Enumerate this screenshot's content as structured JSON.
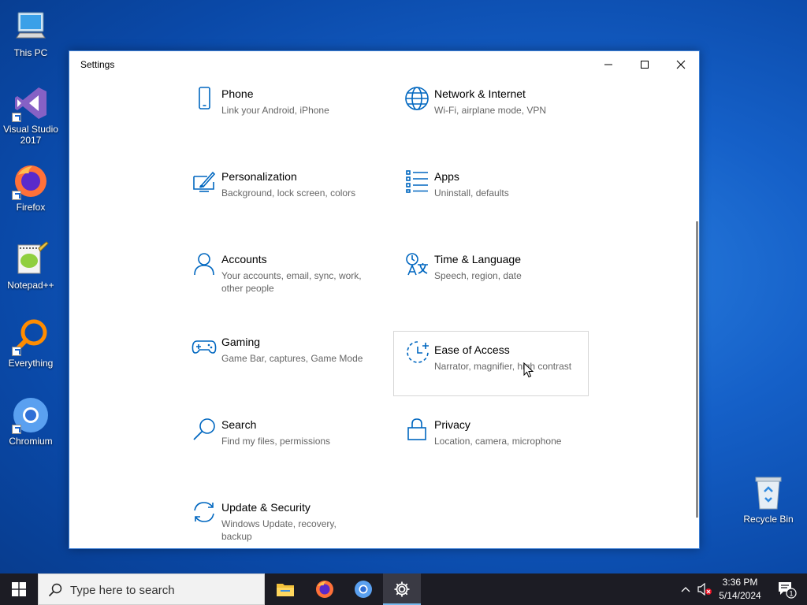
{
  "desktop": {
    "icons": [
      {
        "label": "This PC"
      },
      {
        "label": "Visual Studio 2017"
      },
      {
        "label": "Firefox"
      },
      {
        "label": "Notepad++"
      },
      {
        "label": "Everything"
      },
      {
        "label": "Chromium"
      },
      {
        "label": "Recycle Bin"
      }
    ]
  },
  "window": {
    "title": "Settings",
    "tiles": [
      {
        "name": "Phone",
        "desc": "Link your Android, iPhone",
        "icon": "phone-icon"
      },
      {
        "name": "Network & Internet",
        "desc": "Wi-Fi, airplane mode, VPN",
        "icon": "globe-icon"
      },
      {
        "name": "Personalization",
        "desc": "Background, lock screen, colors",
        "icon": "paintbrush-icon"
      },
      {
        "name": "Apps",
        "desc": "Uninstall, defaults",
        "icon": "apps-list-icon"
      },
      {
        "name": "Accounts",
        "desc": "Your accounts, email, sync, work, other people",
        "icon": "person-icon"
      },
      {
        "name": "Time & Language",
        "desc": "Speech, region, date",
        "icon": "language-icon"
      },
      {
        "name": "Gaming",
        "desc": "Game Bar, captures, Game Mode",
        "icon": "gamepad-icon"
      },
      {
        "name": "Ease of Access",
        "desc": "Narrator, magnifier, high contrast",
        "icon": "ease-of-access-icon"
      },
      {
        "name": "Search",
        "desc": "Find my files, permissions",
        "icon": "search-icon"
      },
      {
        "name": "Privacy",
        "desc": "Location, camera, microphone",
        "icon": "lock-icon"
      },
      {
        "name": "Update & Security",
        "desc": "Windows Update, recovery, backup",
        "icon": "sync-icon"
      }
    ]
  },
  "taskbar": {
    "search_placeholder": "Type here to search",
    "time": "3:36 PM",
    "date": "5/14/2024",
    "notification_count": "1"
  },
  "colors": {
    "accent": "#0067c0",
    "taskbar": "#1c1c24"
  }
}
